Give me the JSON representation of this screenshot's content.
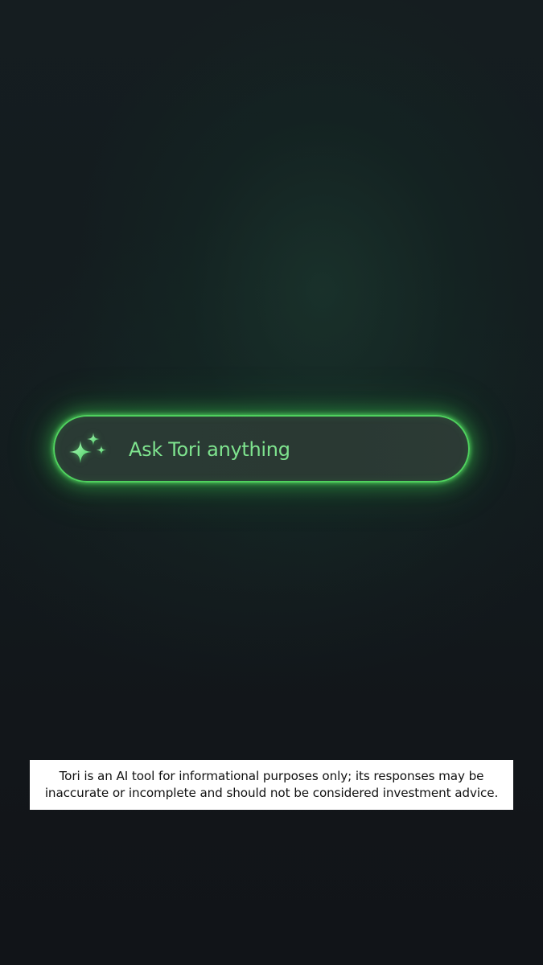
{
  "ask_bar": {
    "placeholder": "Ask Tori anything",
    "icon": "sparkles-icon"
  },
  "disclaimer": {
    "text": "Tori is an AI tool for informational purposes only; its responses may be inaccurate or incomplete and should not be considered investment advice."
  },
  "colors": {
    "accent": "#4fd15e",
    "placeholder_text": "#7ee38e",
    "bar_fill": "#2a3a34",
    "background": "#131b1e"
  }
}
